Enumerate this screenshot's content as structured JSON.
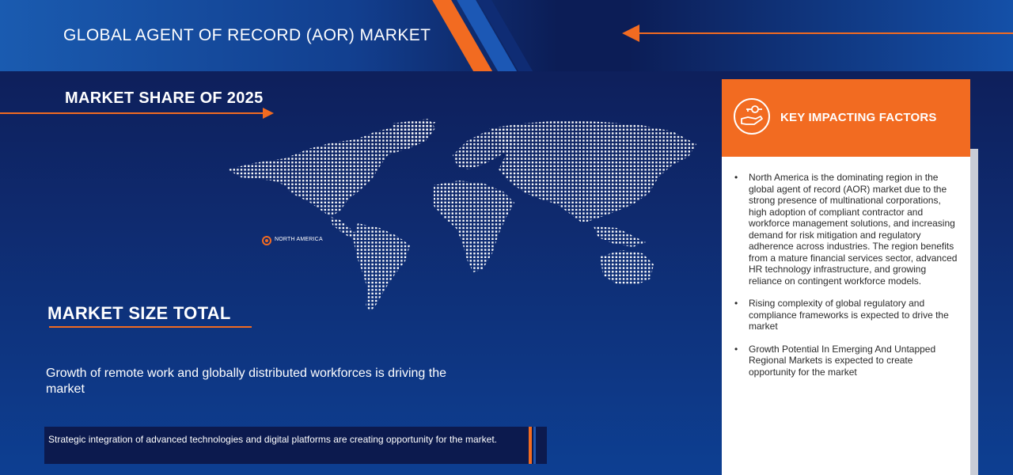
{
  "header": {
    "title": "GLOBAL AGENT OF RECORD (AOR) MARKET",
    "accent_color": "#f26b21"
  },
  "market_share": {
    "title": "MARKET SHARE OF 2025",
    "map_label": "NORTH AMERICA",
    "map_icon": "world-map-dotted"
  },
  "market_size": {
    "title": "MARKET SIZE TOTAL",
    "driver": "Growth of remote work and globally distributed workforces is driving the market"
  },
  "bottom_note": "Strategic integration of advanced technologies and digital platforms are creating opportunity for the market.",
  "key_factors": {
    "title": "KEY IMPACTING FACTORS",
    "icon": "hand-key-icon",
    "items": [
      "North America is the dominating region in the global agent of record (AOR) market due to the strong presence of multinational corporations, high adoption of compliant contractor and workforce management solutions, and increasing demand for risk mitigation and regulatory adherence across industries. The region benefits from a mature financial services sector, advanced HR technology infrastructure, and growing reliance on contingent workforce models.",
      "Rising complexity of global regulatory and compliance frameworks is expected to drive the market",
      "Growth Potential In Emerging And Untapped Regional Markets is expected to create opportunity for the market"
    ]
  }
}
